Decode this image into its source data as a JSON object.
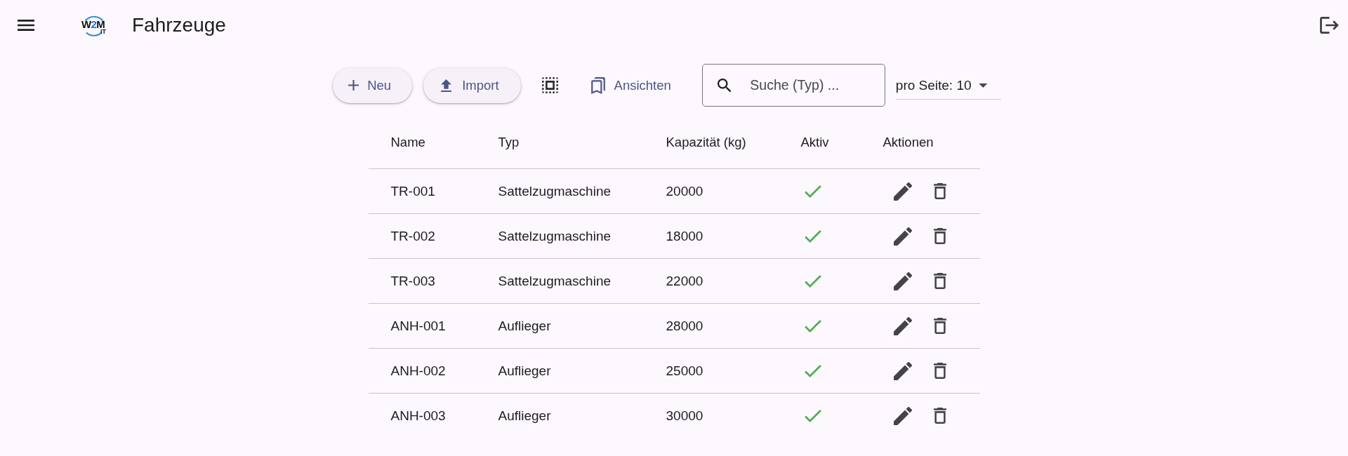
{
  "header": {
    "logo": {
      "parts": [
        {
          "text": "W",
          "accent": false
        },
        {
          "text": "2",
          "accent": true
        },
        {
          "text": "M",
          "accent": false
        }
      ],
      "subtitle": "IT"
    },
    "title": "Fahrzeuge"
  },
  "toolbar": {
    "new_button": {
      "label": "Neu"
    },
    "import_button": {
      "label": "Import"
    },
    "views_button": {
      "label": "Ansichten"
    },
    "search": {
      "placeholder": "Suche (Typ) ..."
    },
    "page_size": {
      "value": "pro Seite: 10"
    }
  },
  "table": {
    "columns": [
      "Name",
      "Typ",
      "Kapazität (kg)",
      "Aktiv",
      "Aktionen"
    ],
    "rows": [
      {
        "name": "TR-001",
        "type": "Sattelzugmaschine",
        "capacity": "20000",
        "active": true
      },
      {
        "name": "TR-002",
        "type": "Sattelzugmaschine",
        "capacity": "18000",
        "active": true
      },
      {
        "name": "TR-003",
        "type": "Sattelzugmaschine",
        "capacity": "22000",
        "active": true
      },
      {
        "name": "ANH-001",
        "type": "Auflieger",
        "capacity": "28000",
        "active": true
      },
      {
        "name": "ANH-002",
        "type": "Auflieger",
        "capacity": "25000",
        "active": true
      },
      {
        "name": "ANH-003",
        "type": "Auflieger",
        "capacity": "30000",
        "active": true
      }
    ]
  }
}
